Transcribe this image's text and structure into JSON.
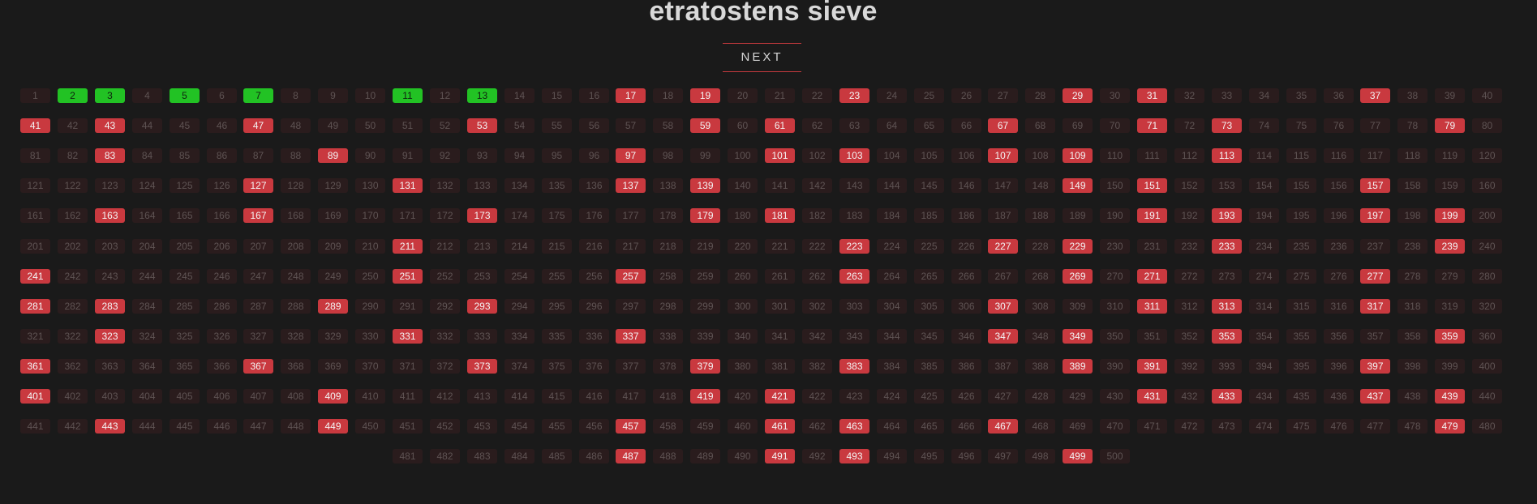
{
  "header": {
    "title": "etratostens sieve"
  },
  "controls": {
    "next_label": "NEXT"
  },
  "sieve": {
    "range_start": 1,
    "range_end": 500,
    "per_row": 40,
    "last_row_indent": 10,
    "found_primes": [
      2,
      3,
      5,
      7,
      11,
      13
    ],
    "marked_primes": [
      17,
      19,
      23,
      29,
      31,
      37,
      41,
      43,
      47,
      53,
      59,
      61,
      67,
      71,
      73,
      79,
      83,
      89,
      97,
      101,
      103,
      107,
      109,
      113,
      127,
      131,
      137,
      139,
      149,
      151,
      157,
      163,
      167,
      173,
      179,
      181,
      191,
      193,
      197,
      199,
      211,
      223,
      227,
      229,
      233,
      239,
      241,
      251,
      257,
      263,
      269,
      271,
      277,
      281,
      283,
      289,
      293,
      307,
      311,
      313,
      317,
      323,
      331,
      337,
      347,
      349,
      353,
      359,
      361,
      367,
      373,
      379,
      383,
      389,
      391,
      397,
      401,
      409,
      419,
      421,
      431,
      433,
      437,
      439,
      443,
      449,
      457,
      461,
      463,
      467,
      479,
      487,
      491,
      493,
      499
    ],
    "colors": {
      "background": "#1a1a1a",
      "cell_default": "#2a1c1d",
      "cell_default_text": "#5e5353",
      "cell_marked": "#c9393f",
      "cell_found": "#22c224",
      "accent": "#c73a3e"
    }
  }
}
